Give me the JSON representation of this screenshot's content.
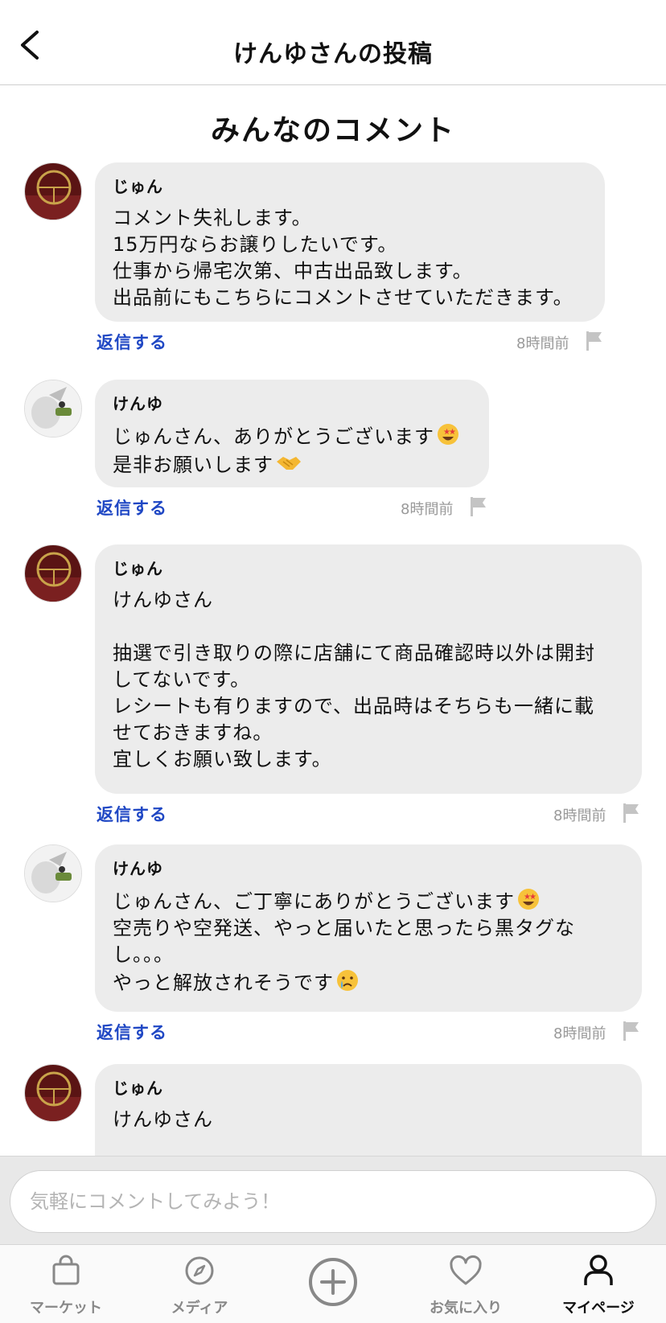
{
  "header": {
    "title": "けんゆさんの投稿"
  },
  "section_title": "みんなのコメント",
  "comments": [
    {
      "author": "じゅん",
      "lines": [
        "コメント失礼します。",
        "15万円ならお譲りしたいです。",
        "仕事から帰宅次第、中古出品致します。",
        "出品前にもこちらにコメントさせていただきます。"
      ],
      "reply_label": "返信する",
      "time": "8時間前"
    },
    {
      "author": "けんゆ",
      "lines": [
        "じゅんさん、ありがとうございます",
        "是非お願いします"
      ],
      "emojis": [
        "star-struck-emoji",
        "handshake-emoji"
      ],
      "reply_label": "返信する",
      "time": "8時間前"
    },
    {
      "author": "じゅん",
      "lines": [
        "けんゆさん",
        "",
        "抽選で引き取りの際に店舗にて商品確認時以外は開封",
        "してないです。",
        "レシートも有りますので、出品時はそちらも一緒に載",
        "せておきますね。",
        "宜しくお願い致します。"
      ],
      "reply_label": "返信する",
      "time": "8時間前"
    },
    {
      "author": "けんゆ",
      "lines": [
        "じゅんさん、ご丁寧にありがとうございます",
        "空売りや空発送、やっと届いたと思ったら黒タグな",
        "し。。。",
        "やっと解放されそうです"
      ],
      "emojis": [
        "star-struck-emoji",
        "crying-face-emoji"
      ],
      "reply_label": "返信する",
      "time": "8時間前"
    },
    {
      "author": "じゅん",
      "lines": [
        "けんゆさん"
      ]
    }
  ],
  "input": {
    "placeholder": "気軽にコメントしてみよう！"
  },
  "tabs": [
    {
      "label": "マーケット",
      "icon": "shopping-bag-icon"
    },
    {
      "label": "メディア",
      "icon": "compass-icon"
    },
    {
      "label": "",
      "icon": "plus-circle-icon"
    },
    {
      "label": "お気に入り",
      "icon": "heart-icon"
    },
    {
      "label": "マイページ",
      "icon": "person-icon",
      "active": true
    }
  ],
  "colors": {
    "accent_link": "#1f47c4",
    "bubble": "#ececec",
    "time": "#9a9a9a"
  }
}
